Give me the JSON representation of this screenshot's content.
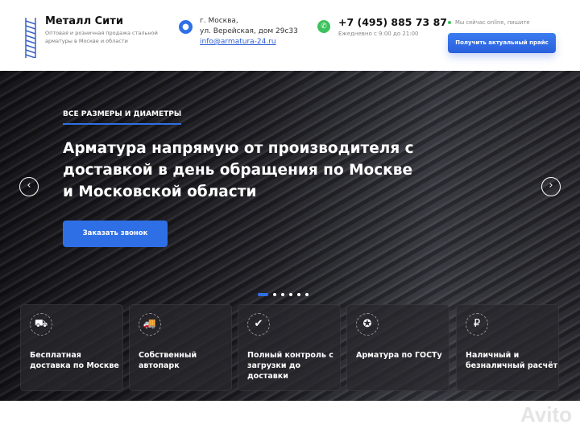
{
  "header": {
    "brand": "Металл Сити",
    "tagline": "Оптовая и розничная продажа стальной арматуры в Москве и области",
    "address_line1": "г. Москва,",
    "address_line2": "ул. Верейская, дом 29с33",
    "email": "info@armatura-24.ru",
    "phone": "+7 (495) 885 73 87",
    "hours": "Ежедневно с 9:00 до 21:00",
    "online_status": "Мы сейчас online, пишите",
    "price_button": "Получить актуальный прайс"
  },
  "hero": {
    "kicker": "ВСЕ РАЗМЕРЫ И ДИАМЕТРЫ",
    "headline": "Арматура напрямую от производителя с доставкой в день обращения по Москве и Московской области",
    "call_button": "Заказать звонок",
    "slides_total": 6,
    "active_slide": 1
  },
  "features": [
    {
      "icon": "delivery-cart-icon",
      "glyph": "⛟",
      "label": "Бесплатная доставка по Москве"
    },
    {
      "icon": "truck-icon",
      "glyph": "🚚",
      "label": "Собственный автопарк"
    },
    {
      "icon": "shield-check-icon",
      "glyph": "✔",
      "label": "Полный контроль с загрузки до доставки"
    },
    {
      "icon": "award-icon",
      "glyph": "✪",
      "label": "Арматура по ГОСТу"
    },
    {
      "icon": "ruble-icon",
      "glyph": "₽",
      "label": "Наличный и безналичный расчёт"
    }
  ],
  "watermark": "Avito",
  "colors": {
    "accent": "#2f6fe6",
    "whatsapp": "#3dc25d"
  }
}
